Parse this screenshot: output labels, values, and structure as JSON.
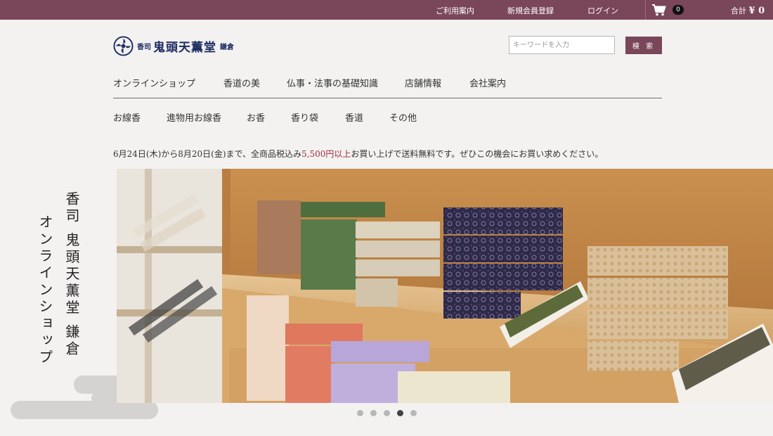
{
  "topbar": {
    "guide": "ご利用案内",
    "register": "新規会員登録",
    "login": "ログイン",
    "cart_count": "0",
    "total_label": "合計",
    "total_value": "¥ 0"
  },
  "header": {
    "logo_small_left": "香司",
    "logo_main": "鬼頭天薫堂",
    "logo_small_right": "鎌倉",
    "search_placeholder": "キーワードを入力",
    "search_button": "検 索"
  },
  "main_nav": [
    "オンラインショップ",
    "香道の美",
    "仏事・法事の基礎知識",
    "店舗情報",
    "会社案内"
  ],
  "sub_nav": [
    "お線香",
    "進物用お線香",
    "お香",
    "香り袋",
    "香道",
    "その他"
  ],
  "notice": {
    "before": "6月24日(木)から8月20日(金)まで、全商品税込み",
    "highlight": "5,500円以上",
    "after": "お買い上げで送料無料です。ぜひこの機会にお買い求めください。"
  },
  "hero": {
    "vertical_line1": "香司 鬼頭天薫堂 鎌倉",
    "vertical_line2": "オンラインショップ"
  },
  "carousel": {
    "count": 5,
    "active_index": 3
  },
  "colors": {
    "accent": "#7a4659",
    "logo": "#1f2e63",
    "highlight": "#9b2b3a"
  }
}
